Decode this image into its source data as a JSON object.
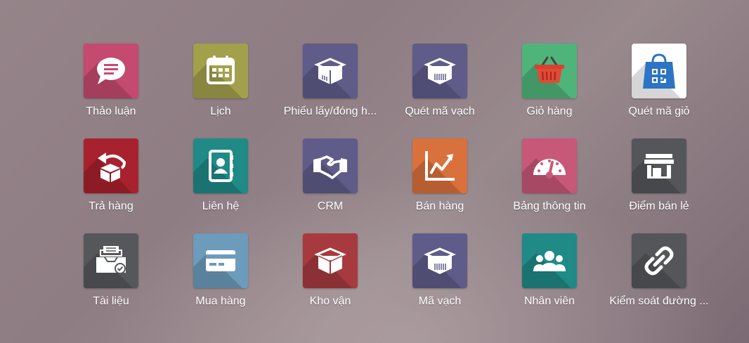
{
  "apps": [
    {
      "label": "Thảo luận",
      "icon": "chat-bubble-icon",
      "color": "#c44a6f"
    },
    {
      "label": "Lịch",
      "icon": "calendar-icon",
      "color": "#a3a04c"
    },
    {
      "label": "Phiếu lấy/đóng h...",
      "icon": "box-icon",
      "color": "#5f5c8a"
    },
    {
      "label": "Quét mã vạch",
      "icon": "box-barcode-icon",
      "color": "#5f5c8a"
    },
    {
      "label": "Giỏ hàng",
      "icon": "shopping-basket-icon",
      "color": "#4fb47a"
    },
    {
      "label": "Quét mã giỏ",
      "icon": "qr-bag-icon",
      "color": "#ffffff"
    },
    {
      "label": "Trả hàng",
      "icon": "return-box-icon",
      "color": "#a8212e"
    },
    {
      "label": "Liên hệ",
      "icon": "address-book-icon",
      "color": "#1f8a86"
    },
    {
      "label": "CRM",
      "icon": "handshake-icon",
      "color": "#5f5c8a"
    },
    {
      "label": "Bán hàng",
      "icon": "trend-chart-icon",
      "color": "#d9713c"
    },
    {
      "label": "Bảng thông tin",
      "icon": "gauge-icon",
      "color": "#c85878"
    },
    {
      "label": "Điểm bán lẻ",
      "icon": "store-icon",
      "color": "#54565a"
    },
    {
      "label": "Tài liệu",
      "icon": "document-tray-icon",
      "color": "#55585b"
    },
    {
      "label": "Mua hàng",
      "icon": "credit-card-icon",
      "color": "#6d9bbb"
    },
    {
      "label": "Kho vận",
      "icon": "box-icon",
      "color": "#a63a3e"
    },
    {
      "label": "Mã vạch",
      "icon": "box-barcode-icon",
      "color": "#5f5c8a"
    },
    {
      "label": "Nhân viên",
      "icon": "people-icon",
      "color": "#1f8a86"
    },
    {
      "label": "Kiểm soát đường ...",
      "icon": "link-chain-icon",
      "color": "#54565a"
    }
  ]
}
